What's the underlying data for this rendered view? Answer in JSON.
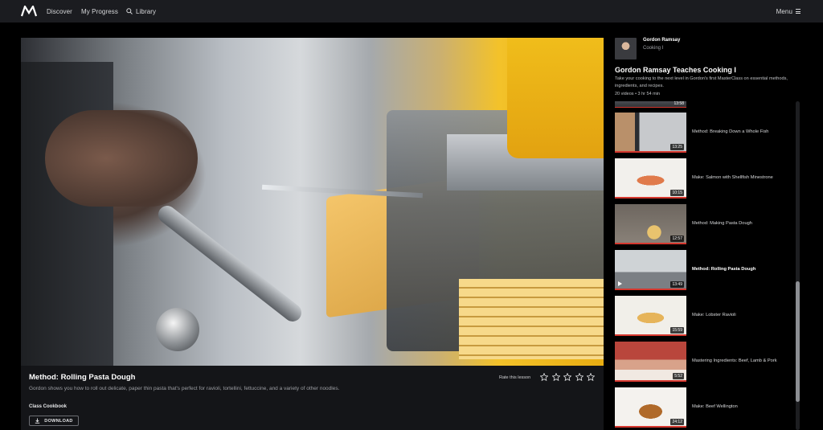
{
  "nav": {
    "discover": "Discover",
    "my_progress": "My Progress",
    "library": "Library",
    "menu": "Menu"
  },
  "lesson": {
    "title": "Method: Rolling Pasta Dough",
    "description": "Gordon shows you how to roll out delicate, paper thin pasta that's perfect for ravioli, tortellini, fettuccine, and a variety of other noodles.",
    "cookbook_label": "Class Cookbook",
    "download_label": "DOWNLOAD",
    "rate_label": "Rate this lesson",
    "rating_stars_total": 5,
    "rating_value": 0
  },
  "instructor": {
    "name": "Gordon Ramsay",
    "course": "Cooking I"
  },
  "course": {
    "title": "Gordon Ramsay Teaches Cooking I",
    "description": "Take your cooking to the next level in Gordon's first MasterClass on essential methods, ingredients, and recipes.",
    "meta": "20 videos • 3 hr 54 min",
    "partial_top_duration": "13:58"
  },
  "playlist": [
    {
      "title": "Method: Breaking Down a Whole Fish",
      "duration": "13:25",
      "current": false,
      "thumb": "fish"
    },
    {
      "title": "Make: Salmon with Shellfish Minestrone",
      "duration": "10:15",
      "current": false,
      "thumb": "salmon"
    },
    {
      "title": "Method: Making Pasta Dough",
      "duration": "12:57",
      "current": false,
      "thumb": "dough"
    },
    {
      "title": "Method: Rolling Pasta Dough",
      "duration": "13:49",
      "current": true,
      "thumb": "kitchen"
    },
    {
      "title": "Make: Lobster Ravioli",
      "duration": "15:59",
      "current": false,
      "thumb": "ravioli"
    },
    {
      "title": "Mastering Ingredients: Beef, Lamb & Pork",
      "duration": "5:52",
      "current": false,
      "thumb": "meat"
    },
    {
      "title": "Make: Beef Wellington",
      "duration": "24:12",
      "current": false,
      "thumb": "wellington"
    }
  ],
  "colors": {
    "progress_accent": "#d5372e",
    "topbar_bg": "#1b1c20",
    "panel_bg": "#141518"
  }
}
